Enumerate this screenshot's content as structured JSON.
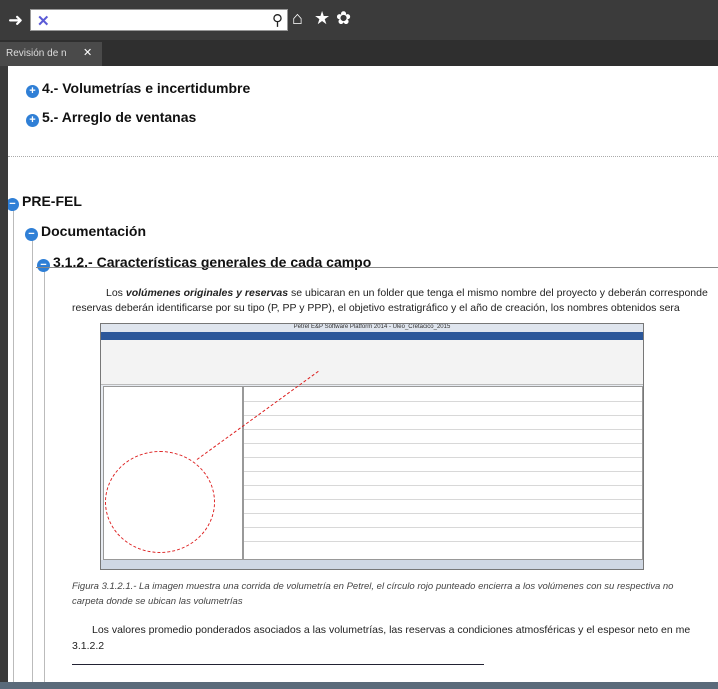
{
  "toolbar": {
    "search_icon": "search-icon",
    "home_icon": "home-icon",
    "star_icon": "star-icon",
    "gear_icon": "gear-icon",
    "nav_icon": "arrow-right-icon"
  },
  "tab": {
    "label": "Revisión de n",
    "close": "✕"
  },
  "sections": {
    "s4": "4.- Volumetrías e incertidumbre",
    "s5": "5.- Arreglo de ventanas",
    "prefel": "PRE-FEL",
    "doc": "Documentación",
    "sub": "3.1.2.- Características generales de cada campo"
  },
  "body": {
    "p1a_pre": "Los ",
    "p1a_em": "volúmenes originales y reservas",
    "p1a_post": " se ubicaran en un folder que tenga el mismo nombre del proyecto y deberán corresponde",
    "p1b": "reservas deberán identificarse por su tipo (P, PP y PPP), el objetivo estratigráfico y el año de creación, los nombres obtenidos sera",
    "caption1": "Figura 3.1.2.1.- La imagen muestra una corrida de volumetría en Petrel, el círculo rojo punteado encierra a los volúmenes con su respectiva no",
    "caption2": "carpeta donde se ubican las volumetrías",
    "p2a": "Los valores promedio ponderados asociados a las volumetrías, las reservas a condiciones atmosféricas y el espesor neto en me",
    "p2b": "3.1.2.2"
  },
  "embedded": {
    "title": "Petrel E&P Software Platform 2014 - Uleo_Cretacico_2015"
  }
}
